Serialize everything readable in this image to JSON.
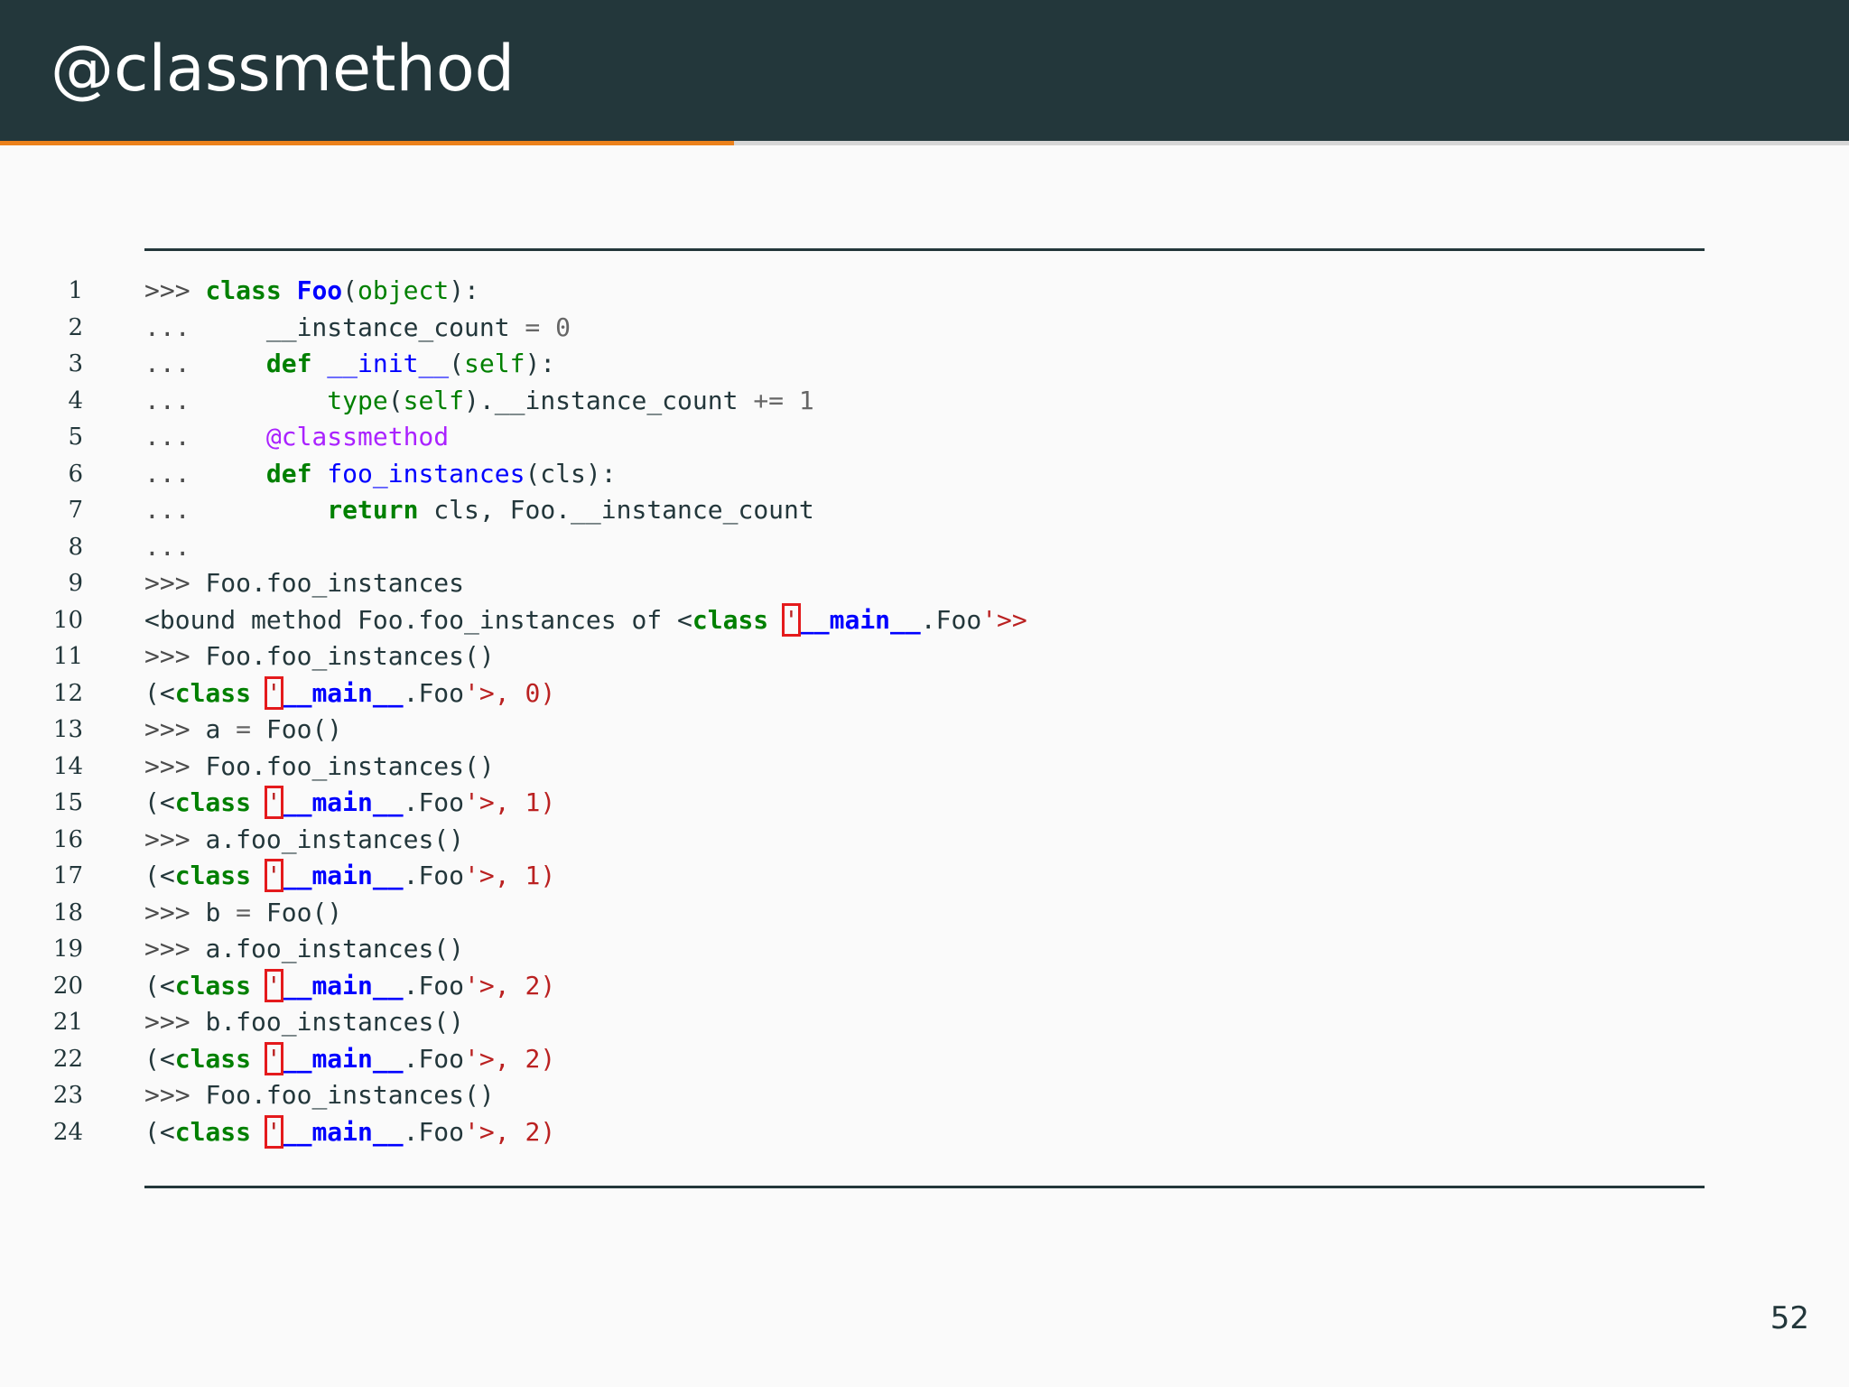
{
  "slide": {
    "title": "@classmethod",
    "page_number": "52",
    "progress": 0.397,
    "colors": {
      "header_background": "#23373b",
      "progress_accent": "#eb811b",
      "page_background": "#fafafa",
      "keyword_green": "#008000",
      "name_blue": "#0000ff",
      "string_red": "#ba2121",
      "decorator_purple": "#aa22ff",
      "error_box_red": "#e41a1c"
    }
  },
  "code": {
    "lines": [
      {
        "no": "1",
        "tokens": [
          {
            "t": ">>> ",
            "c": "prompt"
          },
          {
            "t": "class",
            "c": "kw"
          },
          {
            "t": " ",
            "c": "plain"
          },
          {
            "t": "Foo",
            "c": "cls"
          },
          {
            "t": "(",
            "c": "plain"
          },
          {
            "t": "object",
            "c": "builtin"
          },
          {
            "t": "):",
            "c": "plain"
          }
        ]
      },
      {
        "no": "2",
        "tokens": [
          {
            "t": "...     ",
            "c": "prompt"
          },
          {
            "t": "__instance_count",
            "c": "plain"
          },
          {
            "t": " = ",
            "c": "op"
          },
          {
            "t": "0",
            "c": "num"
          }
        ]
      },
      {
        "no": "3",
        "tokens": [
          {
            "t": "...     ",
            "c": "prompt"
          },
          {
            "t": "def",
            "c": "kw"
          },
          {
            "t": " ",
            "c": "plain"
          },
          {
            "t": "__init__",
            "c": "fn"
          },
          {
            "t": "(",
            "c": "plain"
          },
          {
            "t": "self",
            "c": "builtin"
          },
          {
            "t": "):",
            "c": "plain"
          }
        ]
      },
      {
        "no": "4",
        "tokens": [
          {
            "t": "...         ",
            "c": "prompt"
          },
          {
            "t": "type",
            "c": "builtin"
          },
          {
            "t": "(",
            "c": "plain"
          },
          {
            "t": "self",
            "c": "builtin"
          },
          {
            "t": ").__instance_count",
            "c": "plain"
          },
          {
            "t": " += ",
            "c": "op"
          },
          {
            "t": "1",
            "c": "num"
          }
        ]
      },
      {
        "no": "5",
        "tokens": [
          {
            "t": "...     ",
            "c": "prompt"
          },
          {
            "t": "@classmethod",
            "c": "deco"
          }
        ]
      },
      {
        "no": "6",
        "tokens": [
          {
            "t": "...     ",
            "c": "prompt"
          },
          {
            "t": "def",
            "c": "kw"
          },
          {
            "t": " ",
            "c": "plain"
          },
          {
            "t": "foo_instances",
            "c": "fn"
          },
          {
            "t": "(cls):",
            "c": "plain"
          }
        ]
      },
      {
        "no": "7",
        "tokens": [
          {
            "t": "...         ",
            "c": "prompt"
          },
          {
            "t": "return",
            "c": "kw"
          },
          {
            "t": " cls, Foo.__instance_count",
            "c": "plain"
          }
        ]
      },
      {
        "no": "8",
        "tokens": [
          {
            "t": "...",
            "c": "prompt"
          }
        ]
      },
      {
        "no": "9",
        "tokens": [
          {
            "t": ">>> ",
            "c": "prompt"
          },
          {
            "t": "Foo.foo_instances",
            "c": "plain"
          }
        ]
      },
      {
        "no": "10",
        "tokens": [
          {
            "t": "<bound method Foo.foo_instances of <",
            "c": "plain"
          },
          {
            "t": "class",
            "c": "kw"
          },
          {
            "t": " ",
            "c": "plain"
          },
          {
            "t": "'",
            "c": "err"
          },
          {
            "t": "__main__",
            "c": "cls"
          },
          {
            "t": ".Foo",
            "c": "plain"
          },
          {
            "t": "'>>",
            "c": "str"
          }
        ]
      },
      {
        "no": "11",
        "tokens": [
          {
            "t": ">>> ",
            "c": "prompt"
          },
          {
            "t": "Foo.foo_instances()",
            "c": "plain"
          }
        ]
      },
      {
        "no": "12",
        "tokens": [
          {
            "t": "(<",
            "c": "plain"
          },
          {
            "t": "class",
            "c": "kw"
          },
          {
            "t": " ",
            "c": "plain"
          },
          {
            "t": "'",
            "c": "err"
          },
          {
            "t": "__main__",
            "c": "cls"
          },
          {
            "t": ".Foo",
            "c": "plain"
          },
          {
            "t": "'>, 0)",
            "c": "outnum"
          }
        ]
      },
      {
        "no": "13",
        "tokens": [
          {
            "t": ">>> ",
            "c": "prompt"
          },
          {
            "t": "a",
            "c": "plain"
          },
          {
            "t": " = ",
            "c": "op"
          },
          {
            "t": "Foo()",
            "c": "plain"
          }
        ]
      },
      {
        "no": "14",
        "tokens": [
          {
            "t": ">>> ",
            "c": "prompt"
          },
          {
            "t": "Foo.foo_instances()",
            "c": "plain"
          }
        ]
      },
      {
        "no": "15",
        "tokens": [
          {
            "t": "(<",
            "c": "plain"
          },
          {
            "t": "class",
            "c": "kw"
          },
          {
            "t": " ",
            "c": "plain"
          },
          {
            "t": "'",
            "c": "err"
          },
          {
            "t": "__main__",
            "c": "cls"
          },
          {
            "t": ".Foo",
            "c": "plain"
          },
          {
            "t": "'>, 1)",
            "c": "outnum"
          }
        ]
      },
      {
        "no": "16",
        "tokens": [
          {
            "t": ">>> ",
            "c": "prompt"
          },
          {
            "t": "a.foo_instances()",
            "c": "plain"
          }
        ]
      },
      {
        "no": "17",
        "tokens": [
          {
            "t": "(<",
            "c": "plain"
          },
          {
            "t": "class",
            "c": "kw"
          },
          {
            "t": " ",
            "c": "plain"
          },
          {
            "t": "'",
            "c": "err"
          },
          {
            "t": "__main__",
            "c": "cls"
          },
          {
            "t": ".Foo",
            "c": "plain"
          },
          {
            "t": "'>, 1)",
            "c": "outnum"
          }
        ]
      },
      {
        "no": "18",
        "tokens": [
          {
            "t": ">>> ",
            "c": "prompt"
          },
          {
            "t": "b",
            "c": "plain"
          },
          {
            "t": " = ",
            "c": "op"
          },
          {
            "t": "Foo()",
            "c": "plain"
          }
        ]
      },
      {
        "no": "19",
        "tokens": [
          {
            "t": ">>> ",
            "c": "prompt"
          },
          {
            "t": "a.foo_instances()",
            "c": "plain"
          }
        ]
      },
      {
        "no": "20",
        "tokens": [
          {
            "t": "(<",
            "c": "plain"
          },
          {
            "t": "class",
            "c": "kw"
          },
          {
            "t": " ",
            "c": "plain"
          },
          {
            "t": "'",
            "c": "err"
          },
          {
            "t": "__main__",
            "c": "cls"
          },
          {
            "t": ".Foo",
            "c": "plain"
          },
          {
            "t": "'>, 2)",
            "c": "outnum"
          }
        ]
      },
      {
        "no": "21",
        "tokens": [
          {
            "t": ">>> ",
            "c": "prompt"
          },
          {
            "t": "b.foo_instances()",
            "c": "plain"
          }
        ]
      },
      {
        "no": "22",
        "tokens": [
          {
            "t": "(<",
            "c": "plain"
          },
          {
            "t": "class",
            "c": "kw"
          },
          {
            "t": " ",
            "c": "plain"
          },
          {
            "t": "'",
            "c": "err"
          },
          {
            "t": "__main__",
            "c": "cls"
          },
          {
            "t": ".Foo",
            "c": "plain"
          },
          {
            "t": "'>, 2)",
            "c": "outnum"
          }
        ]
      },
      {
        "no": "23",
        "tokens": [
          {
            "t": ">>> ",
            "c": "prompt"
          },
          {
            "t": "Foo.foo_instances()",
            "c": "plain"
          }
        ]
      },
      {
        "no": "24",
        "tokens": [
          {
            "t": "(<",
            "c": "plain"
          },
          {
            "t": "class",
            "c": "kw"
          },
          {
            "t": " ",
            "c": "plain"
          },
          {
            "t": "'",
            "c": "err"
          },
          {
            "t": "__main__",
            "c": "cls"
          },
          {
            "t": ".Foo",
            "c": "plain"
          },
          {
            "t": "'>, 2)",
            "c": "outnum"
          }
        ]
      }
    ]
  }
}
